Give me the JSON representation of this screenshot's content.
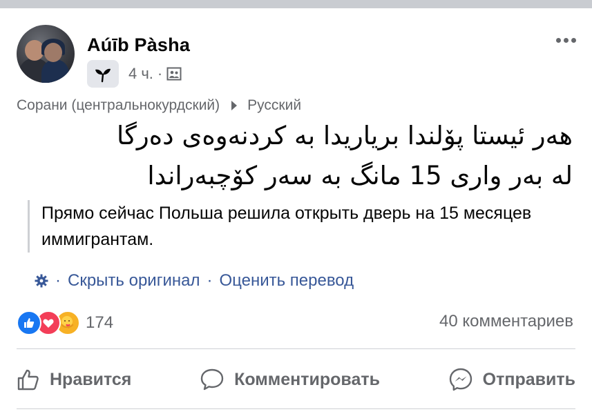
{
  "post": {
    "author": "Aúīb Pàsha",
    "time": "4 ч.",
    "separator": "·",
    "source_language": "Сорани (центральнокурдский)",
    "target_language": "Русский",
    "original_line1": "هەر ئیستا پۆلندا بریاریدا بە کردنەوەی دەرگا",
    "original_line2": "لە بەر واری 15 مانگ بە سەر کۆچبەراندا",
    "translation": "Прямо сейчас Польша решила открыть дверь на 15 месяцев иммигрантам.",
    "hide_original": "Скрыть оригинал",
    "rate_translation": "Оценить перевод",
    "action_separator": "·"
  },
  "stats": {
    "reactions_count": "174",
    "comments_count": "40 комментариев"
  },
  "actions": {
    "like": "Нравится",
    "comment": "Комментировать",
    "share": "Отправить"
  },
  "icons": [
    "more-icon",
    "badge-icon",
    "privacy-icon",
    "translate-arrow-icon",
    "gear-icon",
    "like-reaction-icon",
    "love-reaction-icon",
    "care-reaction-icon",
    "thumbs-up-icon",
    "comment-icon",
    "messenger-icon"
  ],
  "colors": {
    "link": "#385898",
    "secondary_text": "#65676b",
    "like_blue": "#1877f2",
    "love_red": "#f33e58",
    "care_yellow": "#f7b125"
  }
}
